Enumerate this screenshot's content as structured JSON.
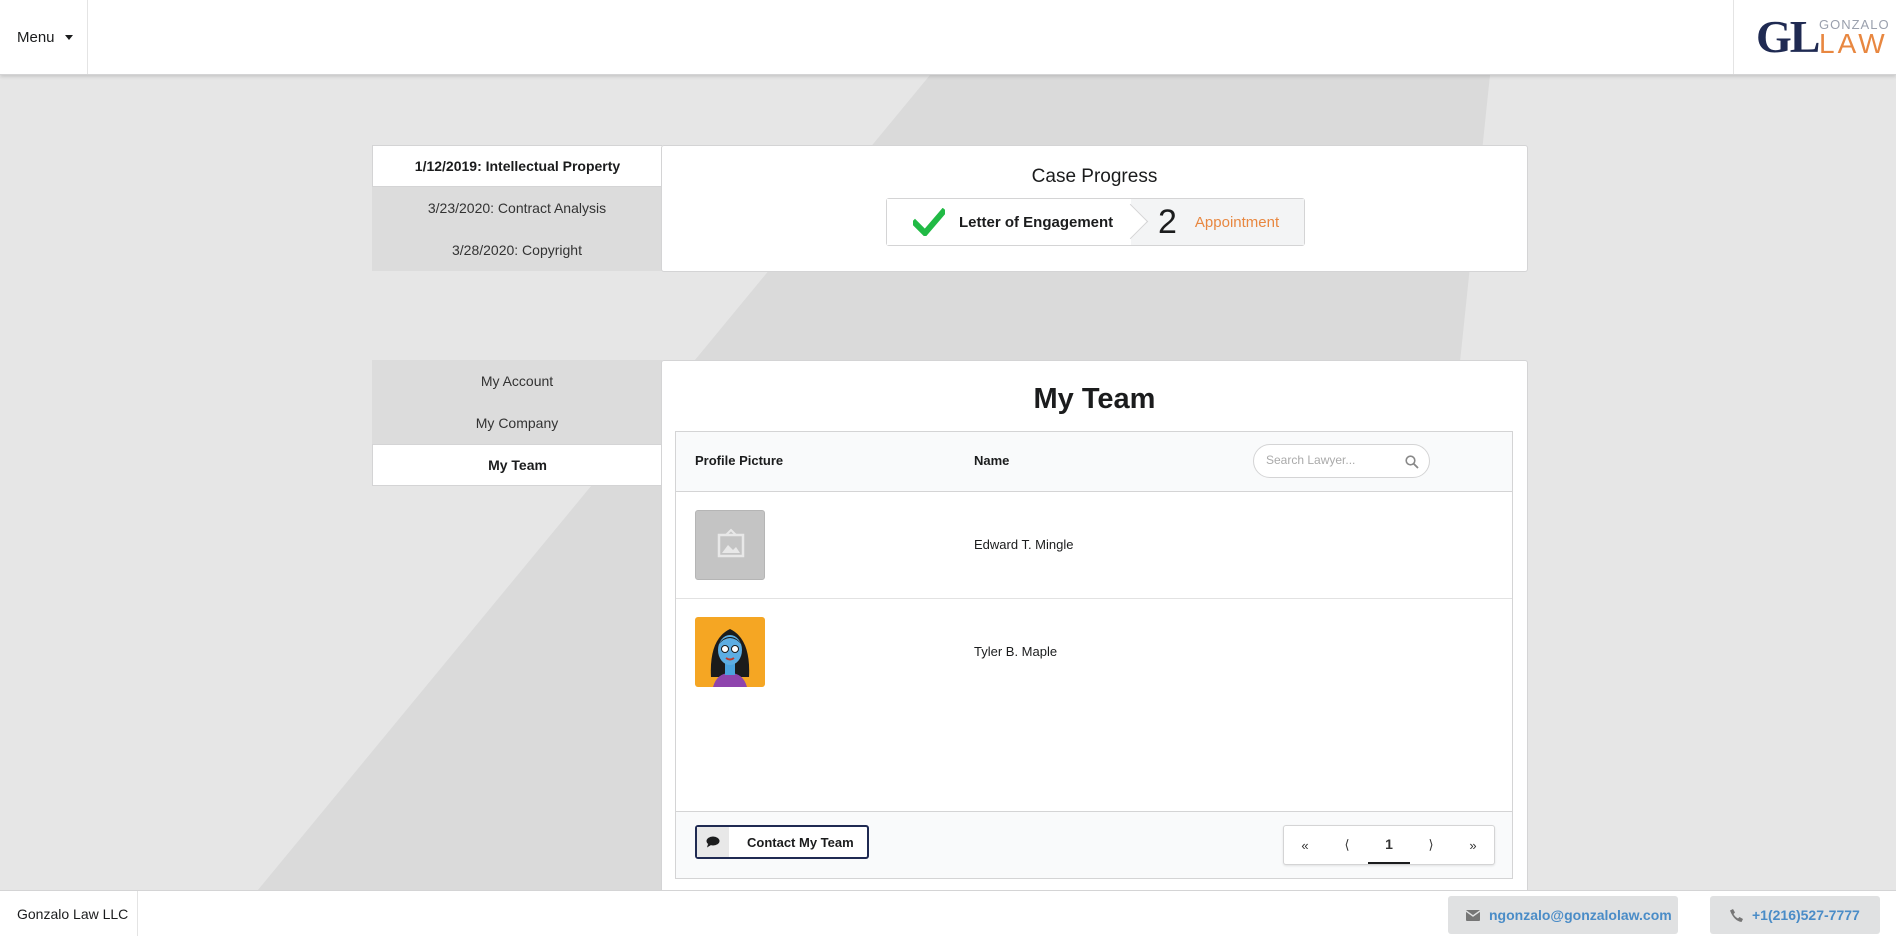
{
  "header": {
    "menu_label": "Menu",
    "logo": {
      "initials": "GL",
      "top_word": "GONZALO",
      "bottom_word": "LAW"
    }
  },
  "cases": {
    "items": [
      {
        "label": "1/12/2019: Intellectual Property",
        "active": true
      },
      {
        "label": "3/23/2020: Contract Analysis",
        "active": false
      },
      {
        "label": "3/28/2020: Copyright",
        "active": false
      }
    ]
  },
  "case_progress": {
    "title": "Case Progress",
    "steps": [
      {
        "label": "Letter of Engagement",
        "status": "completed",
        "icon": "check-icon"
      },
      {
        "number": "2",
        "label": "Appointment",
        "status": "active"
      }
    ]
  },
  "account_nav": {
    "items": [
      {
        "label": "My Account",
        "active": false
      },
      {
        "label": "My Company",
        "active": false
      },
      {
        "label": "My Team",
        "active": true
      }
    ]
  },
  "team": {
    "title": "My Team",
    "columns": {
      "picture": "Profile Picture",
      "name": "Name"
    },
    "search_placeholder": "Search Lawyer...",
    "members": [
      {
        "name": "Edward T. Mingle",
        "avatar": "placeholder-image-icon"
      },
      {
        "name": "Tyler B. Maple",
        "avatar": "woman-avatar"
      }
    ],
    "contact_button": "Contact My Team",
    "pagination": {
      "first": "«",
      "prev": "⟨",
      "current": "1",
      "next": "⟩",
      "last": "»"
    }
  },
  "footer": {
    "company": "Gonzalo Law LLC",
    "email": "ngonzalo@gonzalolaw.com",
    "phone": "+1(216)527-7777"
  },
  "colors": {
    "accent": "#e88740",
    "brand_navy": "#1f2a52",
    "success": "#21ba45",
    "link": "#4a8cc7"
  }
}
